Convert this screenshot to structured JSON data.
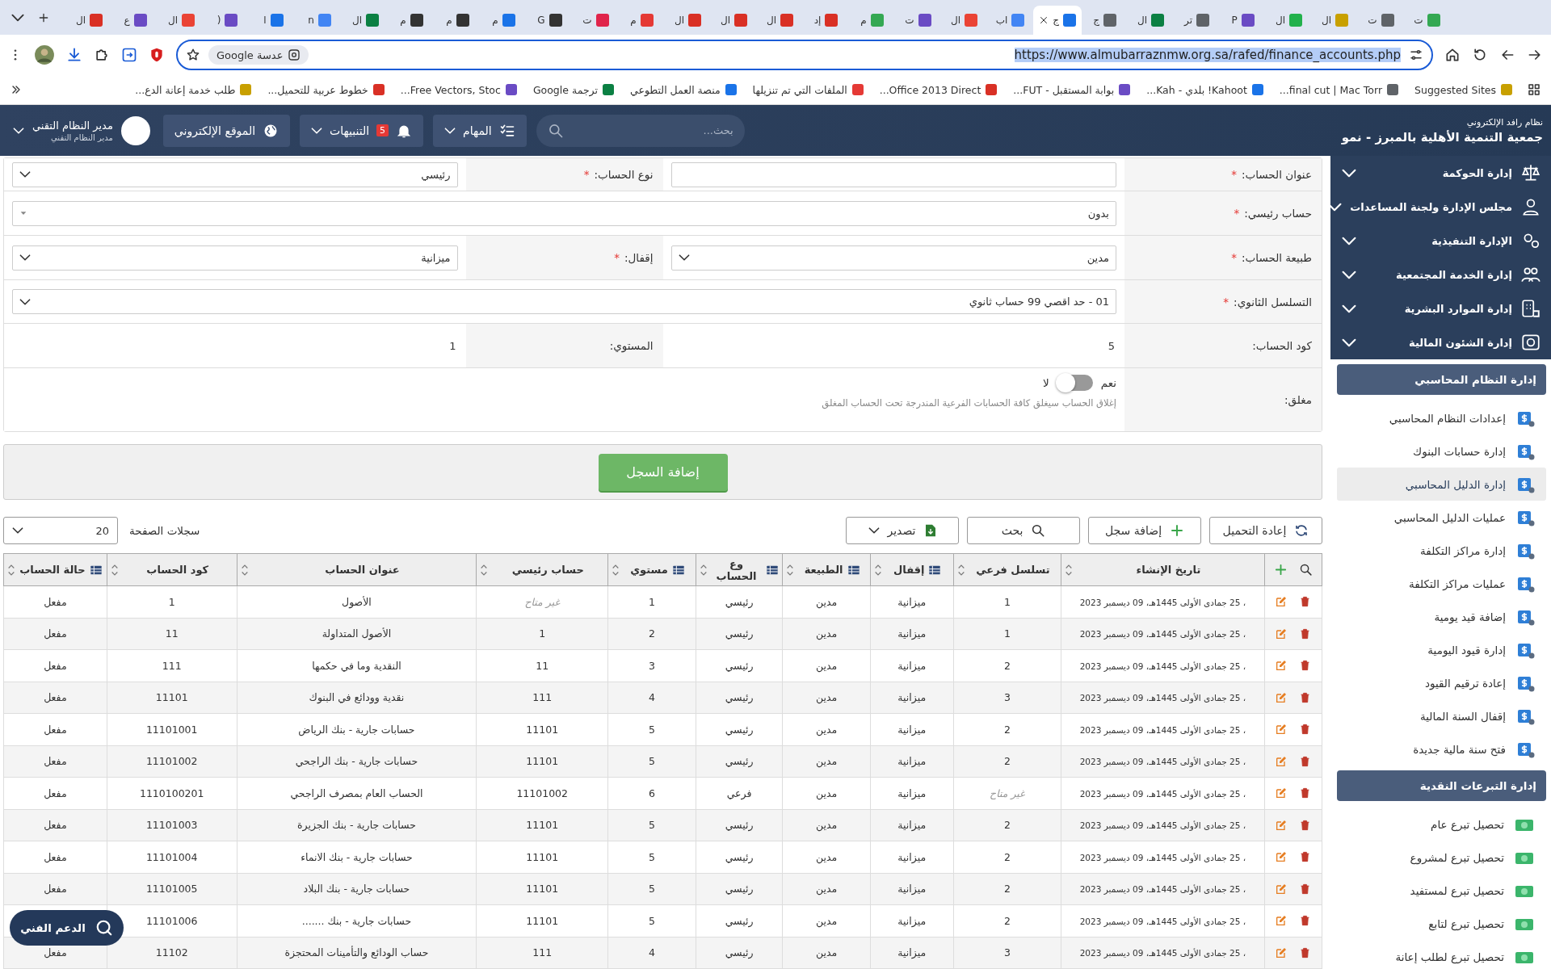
{
  "browser": {
    "tabs": [
      {
        "title": "ت",
        "selected": false
      },
      {
        "title": "ت",
        "selected": false
      },
      {
        "title": "ال",
        "selected": false
      },
      {
        "title": "ال",
        "selected": false
      },
      {
        "title": "P",
        "selected": false
      },
      {
        "title": "تر",
        "selected": false
      },
      {
        "title": "ال",
        "selected": false
      },
      {
        "title": "ج",
        "selected": false
      },
      {
        "title": "ج",
        "selected": true
      },
      {
        "title": "اب",
        "selected": false
      },
      {
        "title": "ال",
        "selected": false
      },
      {
        "title": "ت",
        "selected": false
      },
      {
        "title": "م",
        "selected": false
      },
      {
        "title": "إد",
        "selected": false
      },
      {
        "title": "ال",
        "selected": false
      },
      {
        "title": "ال",
        "selected": false
      },
      {
        "title": "ال",
        "selected": false
      },
      {
        "title": "م",
        "selected": false
      },
      {
        "title": "ت",
        "selected": false
      },
      {
        "title": "G",
        "selected": false
      },
      {
        "title": "م",
        "selected": false
      },
      {
        "title": "م",
        "selected": false
      },
      {
        "title": "م",
        "selected": false
      },
      {
        "title": "ال",
        "selected": false
      },
      {
        "title": "n",
        "selected": false
      },
      {
        "title": "ا",
        "selected": false
      },
      {
        "title": "(",
        "selected": false
      },
      {
        "title": "ال",
        "selected": false
      },
      {
        "title": "ع",
        "selected": false
      },
      {
        "title": "ال",
        "selected": false
      }
    ],
    "address": {
      "lens_chip": "Google عدسة",
      "url": "https://www.almubarraznmw.org.sa/rafed/finance_accounts.php"
    },
    "bookmarks": [
      "Suggested Sites",
      "final cut | Mac Torr...",
      "Kahoot! بلدي - Kah...",
      "بوابة المستقبل - FUT...",
      "Office 2013 Direct...",
      "الملفات التي تم تنزيلها",
      "منصة العمل التطوعي",
      "ترجمة Google",
      "Free Vectors, Stoc...",
      "خطوط عربية للتحميل...",
      "طلب خدمة إعانة الدع..."
    ]
  },
  "header": {
    "system": "نظام رافد الإلكتروني",
    "org": "جمعية التنمية الأهلية بالمبرز - نمو",
    "search": {
      "placeholder": "بحث..."
    },
    "tasks": "المهام",
    "alerts": {
      "label": "التنبيهات",
      "count": "5"
    },
    "website": "الموقع الإلكتروني",
    "user": {
      "name": "مدير النظام التقني",
      "role": "مدير النظام التقني"
    }
  },
  "form": {
    "rows": [
      {
        "fields": [
          {
            "label": "عنوان الحساب:",
            "mark": "*",
            "kind": "input"
          },
          {
            "label": "نوع الحساب:",
            "mark": "*",
            "kind": "select",
            "value": "رئيسي"
          }
        ]
      },
      {
        "fields": [
          {
            "label": "حساب رئيسي:",
            "mark": "*",
            "kind": "combo",
            "value": "بدون"
          }
        ]
      },
      {
        "fields": [
          {
            "label": "طبيعة الحساب:",
            "mark": "*",
            "kind": "select",
            "value": "مدين"
          },
          {
            "label": "إقفال:",
            "mark": "*",
            "kind": "select",
            "value": "ميزانية"
          }
        ]
      },
      {
        "fields": [
          {
            "label": "التسلسل الثانوي:",
            "mark": "*",
            "kind": "select",
            "value": "01 - حد اقصي 99 حساب ثانوي"
          }
        ]
      },
      {
        "fields": [
          {
            "label": "كود الحساب:",
            "kind": "text",
            "value": "5"
          },
          {
            "label": "المستوي:",
            "kind": "text",
            "value": "1"
          }
        ]
      },
      {
        "fields": [
          {
            "label": "مغلق:",
            "kind": "toggle",
            "on_label": "نعم",
            "off_label": "لا",
            "on": false,
            "hint": "إغلاق الحساب سيغلق كافة الحسابات الفرعية المندرجة تحت الحساب المغلق"
          }
        ]
      }
    ],
    "submit": "إضافة السجل"
  },
  "toolbar": {
    "buttons": [
      {
        "kind": "reload",
        "label": "إعادة التحميل"
      },
      {
        "kind": "add",
        "label": "إضافة سجل"
      },
      {
        "kind": "search",
        "label": "بحث"
      },
      {
        "kind": "export",
        "label": "تصدير"
      }
    ],
    "page_size_label": "سجلات الصفحة",
    "page_size": "20"
  },
  "table": {
    "columns": [
      {
        "label": "تاريخ الإنشاء",
        "kind": "plain"
      },
      {
        "label": "تسلسل فرعي",
        "kind": "plain"
      },
      {
        "label": "إقفال",
        "kind": "grid"
      },
      {
        "label": "الطبيعة",
        "kind": "grid"
      },
      {
        "label": "وع الحساب",
        "kind": "grid"
      },
      {
        "label": "مستوي",
        "kind": "grid"
      },
      {
        "label": "حساب رئيسي",
        "kind": "plain"
      },
      {
        "label": "عنوان الحساب",
        "kind": "plain"
      },
      {
        "label": "كود الحساب",
        "kind": "plain"
      },
      {
        "label": "حالة الحساب",
        "kind": "grid"
      }
    ],
    "rows": [
      {
        "cells": [
          "، 25 جمادى الأولى 1445هـ، 09 ديسمبر 2023",
          "1",
          "ميزانية",
          "مدين",
          "رئيسي",
          "1",
          {
            "text": "غير متاح",
            "available": false
          },
          "الأصول",
          "1",
          "مفعل"
        ]
      },
      {
        "cells": [
          "، 25 جمادى الأولى 1445هـ، 09 ديسمبر 2023",
          "1",
          "ميزانية",
          "مدين",
          "رئيسي",
          "2",
          "1",
          "الأصول المتداولة",
          "11",
          "مفعل"
        ]
      },
      {
        "cells": [
          "، 25 جمادى الأولى 1445هـ، 09 ديسمبر 2023",
          "2",
          "ميزانية",
          "مدين",
          "رئيسي",
          "3",
          "11",
          "النقدية وما في حكمها",
          "111",
          "مفعل"
        ]
      },
      {
        "cells": [
          "، 25 جمادى الأولى 1445هـ، 09 ديسمبر 2023",
          "3",
          "ميزانية",
          "مدين",
          "رئيسي",
          "4",
          "111",
          "نقدية وودائع في البنوك",
          "11101",
          "مفعل"
        ]
      },
      {
        "cells": [
          "، 25 جمادى الأولى 1445هـ، 09 ديسمبر 2023",
          "2",
          "ميزانية",
          "مدين",
          "رئيسي",
          "5",
          "11101",
          "حسابات جارية - بنك الرياض",
          "11101001",
          "مفعل"
        ]
      },
      {
        "cells": [
          "، 25 جمادى الأولى 1445هـ، 09 ديسمبر 2023",
          "2",
          "ميزانية",
          "مدين",
          "رئيسي",
          "5",
          "11101",
          "حسابات جارية - بنك الراجحي",
          "11101002",
          "مفعل"
        ]
      },
      {
        "cells": [
          "، 25 جمادى الأولى 1445هـ، 09 ديسمبر 2023",
          {
            "text": "غير متاح",
            "available": false
          },
          "ميزانية",
          "مدين",
          "فرعي",
          "6",
          "11101002",
          "الحساب العام بمصرف الراجحي",
          "1110100201",
          "مفعل"
        ]
      },
      {
        "cells": [
          "، 25 جمادى الأولى 1445هـ، 09 ديسمبر 2023",
          "2",
          "ميزانية",
          "مدين",
          "رئيسي",
          "5",
          "11101",
          "حسابات جارية - بنك الجزيرة",
          "11101003",
          "مفعل"
        ]
      },
      {
        "cells": [
          "، 25 جمادى الأولى 1445هـ، 09 ديسمبر 2023",
          "2",
          "ميزانية",
          "مدين",
          "رئيسي",
          "5",
          "11101",
          "حسابات جارية - بنك الانماء",
          "11101004",
          "مفعل"
        ]
      },
      {
        "cells": [
          "، 25 جمادى الأولى 1445هـ، 09 ديسمبر 2023",
          "2",
          "ميزانية",
          "مدين",
          "رئيسي",
          "5",
          "11101",
          "حسابات جارية - بنك البلاد",
          "11101005",
          "مفعل"
        ]
      },
      {
        "cells": [
          "، 25 جمادى الأولى 1445هـ، 09 ديسمبر 2023",
          "2",
          "ميزانية",
          "مدين",
          "رئيسي",
          "5",
          "11101",
          "حسابات جارية - بنك .......",
          "11101006"
        ]
      },
      {
        "cells": [
          "، 25 جمادى الأولى 1445هـ، 09 ديسمبر 2023",
          "3",
          "ميزانية",
          "مدين",
          "رئيسي",
          "4",
          "111",
          "حساب الودائع والتأمينات المحتجزة",
          "11102",
          "مفعل"
        ]
      }
    ]
  },
  "sidebar": {
    "groups": [
      {
        "label": "إدارة الحوكمة",
        "expanded": false
      },
      {
        "label": "مجلس الإدارة ولجنة المساعدات",
        "expanded": false
      },
      {
        "label": "الإدارة التنفيذية",
        "expanded": false
      },
      {
        "label": "إدارة الخدمة المجتمعية",
        "expanded": false
      },
      {
        "label": "إدارة الموارد البشرية",
        "expanded": false
      },
      {
        "label": "إدارة الشئون المالية",
        "expanded": false
      }
    ],
    "sections": [
      {
        "title": "إدارة النظام المحاسبي",
        "items": [
          {
            "label": "إعدادات النظام المحاسبي",
            "selected": false
          },
          {
            "label": "إدارة حسابات البنوك",
            "selected": false
          },
          {
            "label": "إدارة الدليل المحاسبي",
            "selected": true
          },
          {
            "label": "عمليات الدليل المحاسبي",
            "selected": false
          },
          {
            "label": "إدارة مراكز التكلفة",
            "selected": false
          },
          {
            "label": "عمليات مراكز التكلفة",
            "selected": false
          },
          {
            "label": "إضافة قيد يومية",
            "selected": false
          },
          {
            "label": "إدارة قيود اليومية",
            "selected": false
          },
          {
            "label": "إعادة ترقيم القيود",
            "selected": false
          },
          {
            "label": "إقفال السنة المالية",
            "selected": false
          },
          {
            "label": "فتح سنة مالية جديدة",
            "selected": false
          }
        ]
      },
      {
        "title": "إدارة التبرعات النقدية",
        "items": [
          {
            "label": "تحصيل تبرع عام",
            "selected": false
          },
          {
            "label": "تحصيل تبرع لمشروع",
            "selected": false
          },
          {
            "label": "تحصيل تبرع لمستفيد",
            "selected": false
          },
          {
            "label": "تحصيل تبرع لتابع",
            "selected": false
          },
          {
            "label": "تحصيل تبرع لطلب إعانة",
            "selected": false
          }
        ]
      }
    ]
  },
  "support": "الدعم الفني"
}
